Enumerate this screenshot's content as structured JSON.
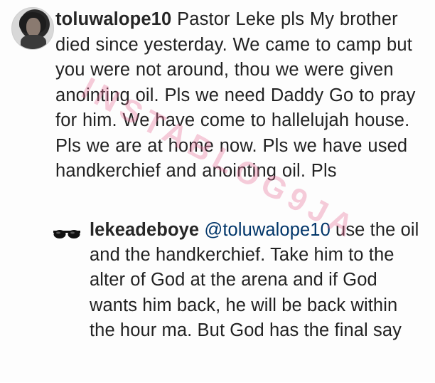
{
  "comment": {
    "username": "toluwalope10",
    "text": "Pastor Leke pls My brother died since yesterday. We came to camp but you were not around, thou we were given anointing oil. Pls we need Daddy Go to pray for him. We have come to hallelujah house. Pls we are at home now. Pls we have used handkerchief and anointing oil. Pls",
    "avatar_icon": "profile-photo"
  },
  "reply": {
    "username": "lekeadeboye",
    "mention": "@toluwalope10",
    "text": "use the oil and the handkerchief.  Take him to the alter of God at the arena and if God wants him back, he will be back within the hour ma. But God has the final say",
    "avatar_icon": "sunglasses-icon"
  },
  "watermark": {
    "text": "INSTABLOG9JA",
    "color": "#e66e96"
  },
  "colors": {
    "text": "#222222",
    "username": "#262626",
    "mention": "#003569",
    "background": "#fdfdfd"
  }
}
